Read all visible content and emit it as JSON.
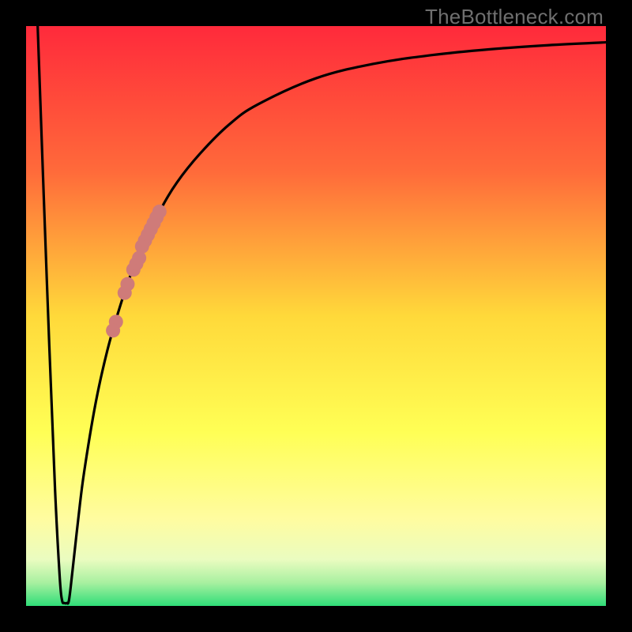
{
  "watermark": "TheBottleneck.com",
  "chart_data": {
    "type": "line",
    "title": "",
    "xlabel": "",
    "ylabel": "",
    "xlim": [
      0,
      100
    ],
    "ylim": [
      0,
      100
    ],
    "grid": false,
    "legend": false,
    "background_gradient": {
      "stops": [
        {
          "offset": 0.0,
          "color": "#ff2a3b"
        },
        {
          "offset": 0.25,
          "color": "#ff6a3a"
        },
        {
          "offset": 0.5,
          "color": "#ffd93a"
        },
        {
          "offset": 0.7,
          "color": "#ffff55"
        },
        {
          "offset": 0.85,
          "color": "#fffca0"
        },
        {
          "offset": 0.92,
          "color": "#eafcc0"
        },
        {
          "offset": 0.96,
          "color": "#a8f0a0"
        },
        {
          "offset": 1.0,
          "color": "#2fdd78"
        }
      ]
    },
    "series": [
      {
        "name": "bottleneck-curve",
        "color": "#000000",
        "points": [
          {
            "x": 2.0,
            "y": 100.0
          },
          {
            "x": 3.0,
            "y": 72.0
          },
          {
            "x": 4.0,
            "y": 45.0
          },
          {
            "x": 5.0,
            "y": 20.0
          },
          {
            "x": 5.8,
            "y": 5.0
          },
          {
            "x": 6.2,
            "y": 1.0
          },
          {
            "x": 6.6,
            "y": 0.5
          },
          {
            "x": 7.0,
            "y": 0.5
          },
          {
            "x": 7.4,
            "y": 1.0
          },
          {
            "x": 8.0,
            "y": 6.0
          },
          {
            "x": 9.0,
            "y": 15.0
          },
          {
            "x": 10.0,
            "y": 23.0
          },
          {
            "x": 12.0,
            "y": 35.0
          },
          {
            "x": 14.0,
            "y": 44.0
          },
          {
            "x": 16.0,
            "y": 51.0
          },
          {
            "x": 18.0,
            "y": 57.0
          },
          {
            "x": 20.0,
            "y": 62.0
          },
          {
            "x": 23.0,
            "y": 68.0
          },
          {
            "x": 26.0,
            "y": 73.0
          },
          {
            "x": 30.0,
            "y": 78.0
          },
          {
            "x": 35.0,
            "y": 83.0
          },
          {
            "x": 40.0,
            "y": 86.5
          },
          {
            "x": 50.0,
            "y": 91.0
          },
          {
            "x": 60.0,
            "y": 93.5
          },
          {
            "x": 70.0,
            "y": 95.0
          },
          {
            "x": 80.0,
            "y": 96.0
          },
          {
            "x": 90.0,
            "y": 96.7
          },
          {
            "x": 100.0,
            "y": 97.2
          }
        ]
      },
      {
        "name": "highlight-dots",
        "color": "#cf7b79",
        "points": [
          {
            "x": 17.0,
            "y": 54.0
          },
          {
            "x": 17.5,
            "y": 55.5
          },
          {
            "x": 18.5,
            "y": 58.0
          },
          {
            "x": 19.0,
            "y": 59.0
          },
          {
            "x": 19.5,
            "y": 60.0
          },
          {
            "x": 20.0,
            "y": 62.0
          },
          {
            "x": 20.5,
            "y": 63.0
          },
          {
            "x": 21.0,
            "y": 64.0
          },
          {
            "x": 21.5,
            "y": 65.0
          },
          {
            "x": 22.0,
            "y": 66.0
          },
          {
            "x": 22.5,
            "y": 67.0
          },
          {
            "x": 23.0,
            "y": 68.0
          },
          {
            "x": 15.5,
            "y": 49.0
          },
          {
            "x": 15.0,
            "y": 47.5
          }
        ]
      }
    ]
  }
}
